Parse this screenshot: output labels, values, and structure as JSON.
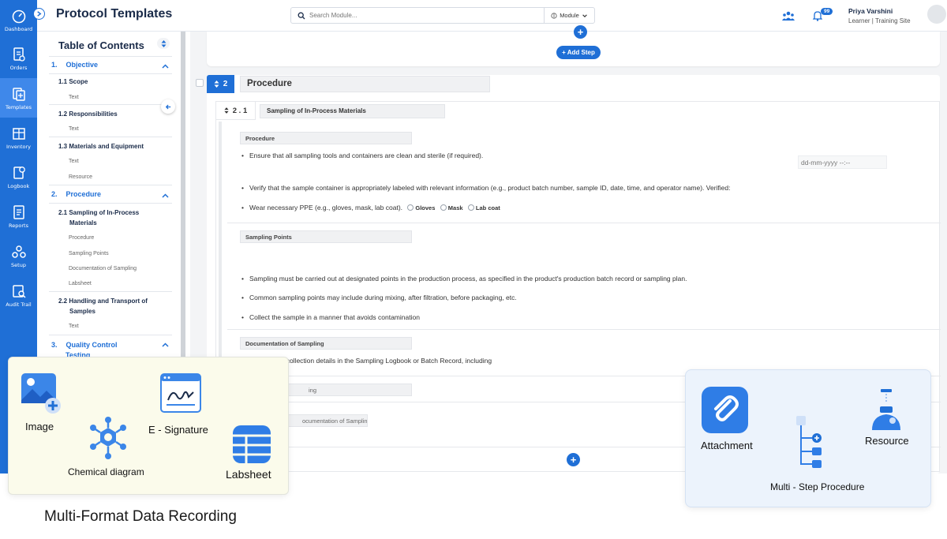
{
  "colors": {
    "brand": "#1f6fd6",
    "brand_light": "#3f88ea",
    "surface": "#f3f4f6"
  },
  "nav": [
    {
      "label": "Dashboard",
      "icon": "gauge-icon",
      "active": false
    },
    {
      "label": "Orders",
      "icon": "orders-icon",
      "active": false
    },
    {
      "label": "Templates",
      "icon": "templates-icon",
      "active": true
    },
    {
      "label": "Inventory",
      "icon": "inventory-icon",
      "active": false
    },
    {
      "label": "Logbook",
      "icon": "logbook-icon",
      "active": false
    },
    {
      "label": "Reports",
      "icon": "reports-icon",
      "active": false
    },
    {
      "label": "Setup",
      "icon": "setup-icon",
      "active": false
    },
    {
      "label": "Audit Trail",
      "icon": "audit-trail-icon",
      "active": false
    }
  ],
  "header": {
    "title": "Protocol Templates",
    "search_placeholder": "Search Module...",
    "module_label": "Module",
    "notifications_count": "99",
    "user_name": "Priya Varshini",
    "user_role": "Learner | Training Site"
  },
  "toc": {
    "title": "Table of Contents",
    "sec1_num": "1.",
    "sec1_title": "Objective",
    "s11": "1.1  Scope",
    "s11_leaf": "Text",
    "s12": "1.2  Responsibilities",
    "s12_leaf": "Text",
    "s13": "1.3  Materials and Equipment",
    "s13_leaf1": "Text",
    "s13_leaf2": "Resource",
    "sec2_num": "2.",
    "sec2_title": "Procedure",
    "s21_a": "2.1  Sampling of In-Process",
    "s21_b": "Materials",
    "s21_leaf1": "Procedure",
    "s21_leaf2": "Sampling Points",
    "s21_leaf3": "Documentation of Sampling",
    "s21_leaf4": "Labsheet",
    "s22_a": "2.2  Handling and Transport of",
    "s22_b": "Samples",
    "s22_leaf": "Text",
    "sec3_num": "3.",
    "sec3_title_a": "Quality Control",
    "sec3_title_b": "Testing"
  },
  "main": {
    "add_step": "+ Add Step",
    "step_number": "2",
    "step_title": "Procedure",
    "sub_number": "2 . 1",
    "sub_title": "Sampling of In-Process Materials",
    "blk1_label": "Procedure",
    "b1": "Ensure that all sampling tools and containers are clean and sterile (if required).",
    "b2": "Verify that the sample container is appropriately labeled with relevant information (e.g., product batch number, sample ID, date, time, and operator name). Verified:",
    "b2_date": "dd-mm-yyyy --:--",
    "b3": "Wear necessary PPE (e.g., gloves, mask, lab coat).",
    "ppe_gloves": "Gloves",
    "ppe_mask": "Mask",
    "ppe_labcoat": "Lab coat",
    "blk2_label": "Sampling Points",
    "b4": "Sampling must be carried out at designated points in the production process, as specified in the product's production batch record or sampling plan.",
    "b5": "Common sampling points may include during mixing, after filtration, before packaging, etc.",
    "b6": "Collect the sample in a manner that avoids contamination",
    "blk3_label": "Documentation of Sampling",
    "record_text": "Record the sample collection details in the Sampling Logbook or Batch Record, including",
    "blk4_fragment": "ing",
    "blk5_fragment": "ocumentation of Samplin"
  },
  "features_left": {
    "image": "Image",
    "esign": "E - Signature",
    "chemical": "Chemical diagram",
    "labsheet": "Labsheet"
  },
  "features_right": {
    "attachment": "Attachment",
    "resource": "Resource",
    "multistep": "Multi - Step Procedure"
  },
  "headline": "Multi-Format Data Recording"
}
